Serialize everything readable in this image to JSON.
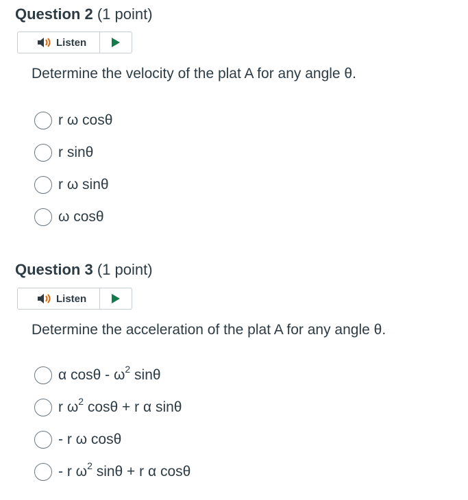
{
  "questions": [
    {
      "title": "Question 2",
      "points": "(1 point)",
      "listen_label": "Listen",
      "prompt": "Determine the velocity of the plat A for any angle θ.",
      "options": [
        "r ω cosθ",
        "r sinθ",
        "r ω sinθ",
        "ω cosθ"
      ]
    },
    {
      "title": "Question 3",
      "points": "(1 point)",
      "listen_label": "Listen",
      "prompt": "Determine the acceleration of the plat A for any angle θ.",
      "options": [
        {
          "pre": "α cosθ - ω",
          "sup": "2",
          "post": " sinθ"
        },
        {
          "pre": "r ω",
          "sup": "2",
          "post": " cosθ + r α sinθ"
        },
        {
          "pre": "- r ω cosθ",
          "sup": "",
          "post": ""
        },
        {
          "pre": "- r ω",
          "sup": "2",
          "post": " sinθ + r α cosθ"
        }
      ]
    }
  ],
  "colors": {
    "speaker": "#2d3b45",
    "speaker_wave": "#e66000",
    "play": "#127a4b"
  },
  "icons": [
    "speaker-icon",
    "play-icon"
  ]
}
